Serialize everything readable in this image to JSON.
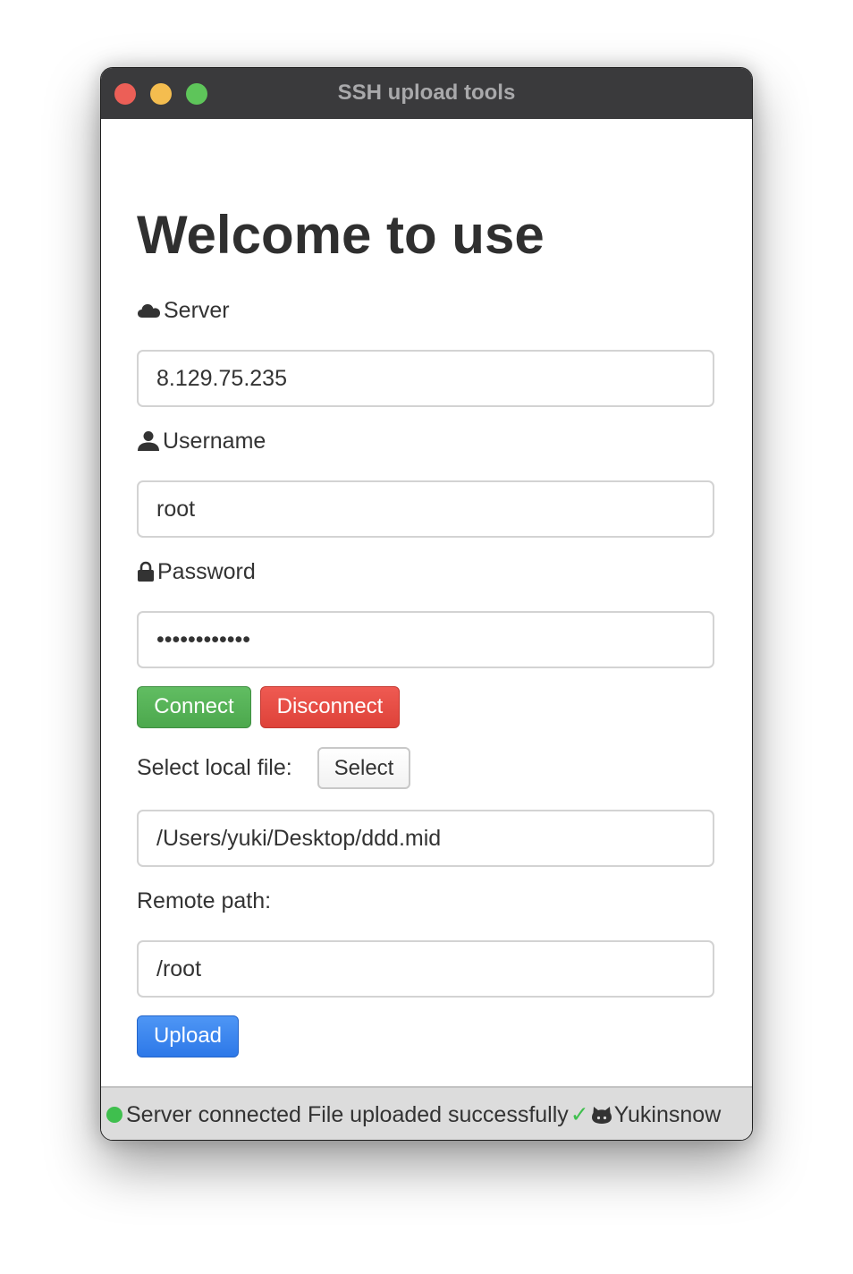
{
  "window": {
    "title": "SSH upload tools"
  },
  "main": {
    "heading": "Welcome to use",
    "server": {
      "label": "Server",
      "value": "8.129.75.235"
    },
    "username": {
      "label": "Username",
      "value": "root"
    },
    "password": {
      "label": "Password",
      "value": "••••••••••••"
    },
    "buttons": {
      "connect": "Connect",
      "disconnect": "Disconnect",
      "select": "Select",
      "upload": "Upload"
    },
    "local_file": {
      "label": "Select local file:",
      "value": "/Users/yuki/Desktop/ddd.mid"
    },
    "remote_path": {
      "label": "Remote path:",
      "value": "/root"
    }
  },
  "status": {
    "connection": "Server connected",
    "upload": "File uploaded successfully",
    "check": "✓",
    "author": "Yukinsnow"
  },
  "icons": {
    "server": "cloud-icon",
    "username": "user-icon",
    "password": "lock-icon",
    "author": "github-icon"
  },
  "colors": {
    "connect": "#5cb85c",
    "disconnect": "#e74c3c",
    "upload": "#3b86f0",
    "status_ok": "#3fbf4e"
  }
}
